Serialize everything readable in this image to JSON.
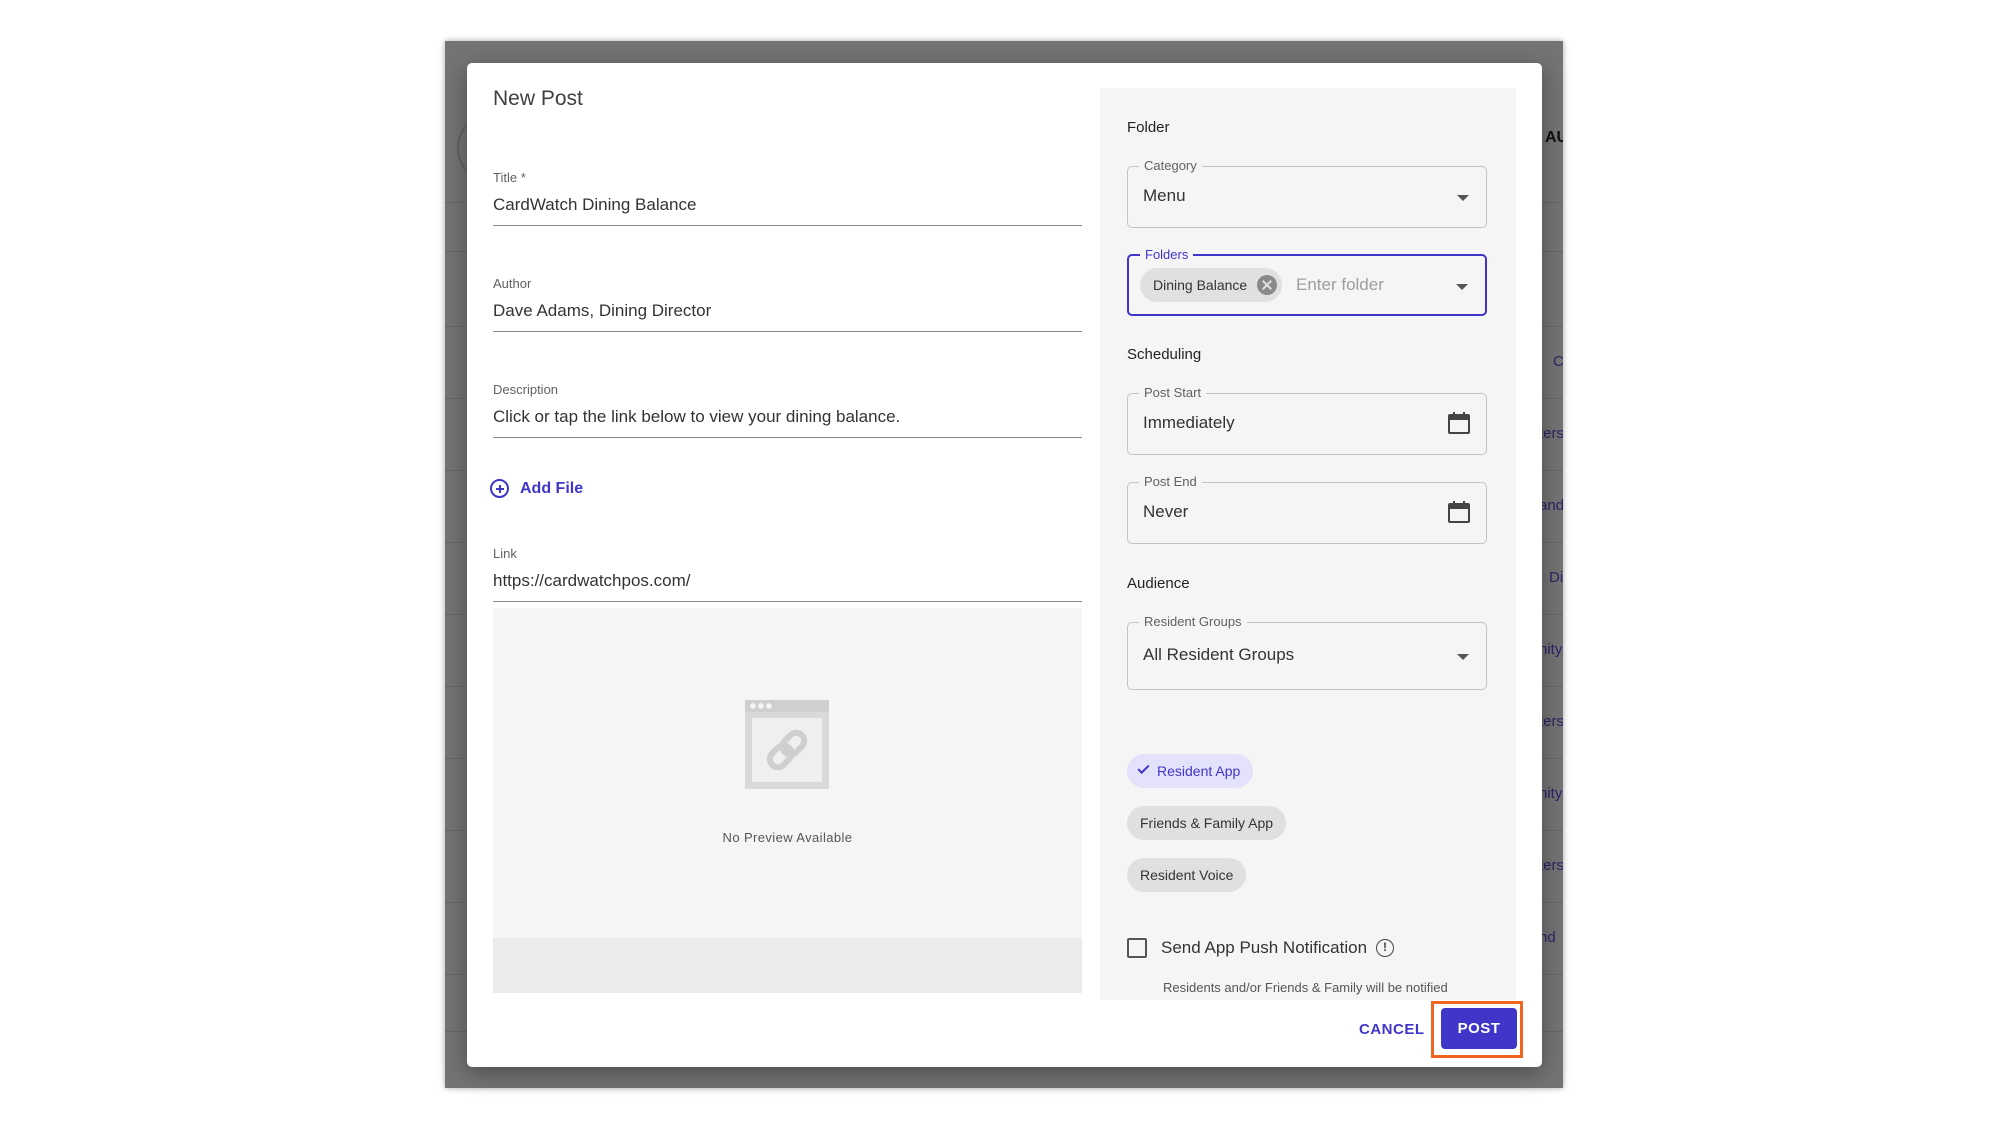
{
  "background": {
    "fragments": [
      "AU",
      "C",
      "ters",
      "and",
      "Di",
      "nity",
      "ters",
      "nity",
      "ters",
      "nd"
    ]
  },
  "dialog": {
    "title": "New Post",
    "fields": {
      "title": {
        "label": "Title *",
        "value": "CardWatch Dining Balance"
      },
      "author": {
        "label": "Author",
        "value": "Dave Adams, Dining Director"
      },
      "description": {
        "label": "Description",
        "value": "Click or tap the link below to view your dining balance."
      },
      "link": {
        "label": "Link",
        "value": "https://cardwatchpos.com/"
      }
    },
    "add_file_label": "Add File",
    "preview": {
      "text": "No Preview Available"
    },
    "folder_section": {
      "heading": "Folder",
      "category": {
        "label": "Category",
        "value": "Menu"
      },
      "folders": {
        "label": "Folders",
        "chip": "Dining Balance",
        "placeholder": "Enter folder"
      }
    },
    "scheduling_section": {
      "heading": "Scheduling",
      "post_start": {
        "label": "Post Start",
        "value": "Immediately"
      },
      "post_end": {
        "label": "Post End",
        "value": "Never"
      }
    },
    "audience_section": {
      "heading": "Audience",
      "resident_groups": {
        "label": "Resident Groups",
        "value": "All Resident Groups"
      },
      "apps": [
        {
          "label": "Resident App",
          "selected": true
        },
        {
          "label": "Friends & Family App",
          "selected": false
        },
        {
          "label": "Resident Voice",
          "selected": false
        }
      ]
    },
    "push": {
      "label": "Send App Push Notification",
      "checked": false,
      "help": "Residents and/or Friends & Family will be notified"
    },
    "actions": {
      "cancel": "CANCEL",
      "post": "POST"
    }
  },
  "colors": {
    "accent": "#3f36c9",
    "highlight": "#f0661f"
  }
}
